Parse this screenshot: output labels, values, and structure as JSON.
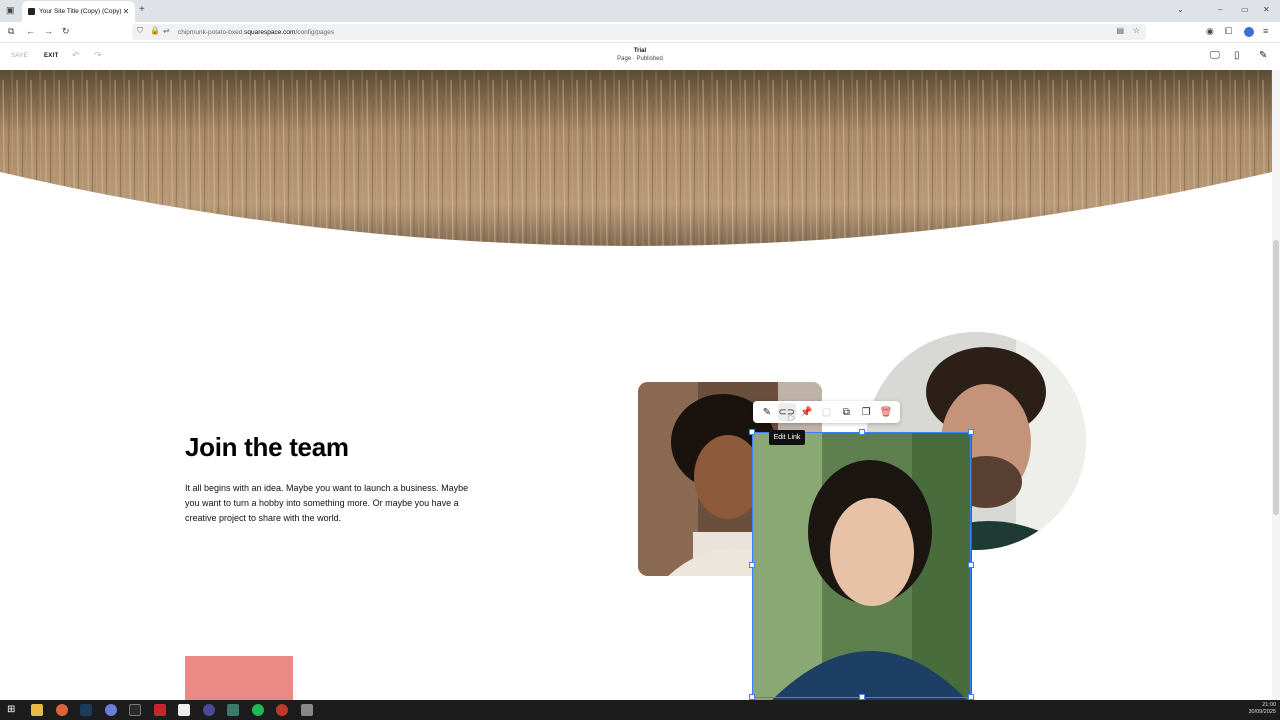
{
  "browser": {
    "tab_title": "Your Site Title (Copy) (Copy)",
    "url_host_prefix": "chipmunk-potato-bxed.",
    "url_host_main": "squarespace.com",
    "url_path": "/config/pages"
  },
  "editor": {
    "save_label": "SAVE",
    "exit_label": "EXIT",
    "page_name": "Trial",
    "page_status": "Page · Published"
  },
  "content": {
    "heading": "Join the team",
    "body": "It all begins with an idea. Maybe you want to launch a business. Maybe you want to turn a hobby into something more. Or maybe you have a creative project to share with the world."
  },
  "image_toolbar": {
    "tools": [
      "edit-pencil",
      "link",
      "pin",
      "crop",
      "duplicate",
      "copy",
      "delete"
    ],
    "tooltip": "Edit Link"
  },
  "taskbar": {
    "time": "21:00",
    "date": "30/09/2025"
  },
  "colors": {
    "accent_selection": "#3b82f6",
    "block_pink": "#ea8a86",
    "delete_red": "#d33333"
  }
}
